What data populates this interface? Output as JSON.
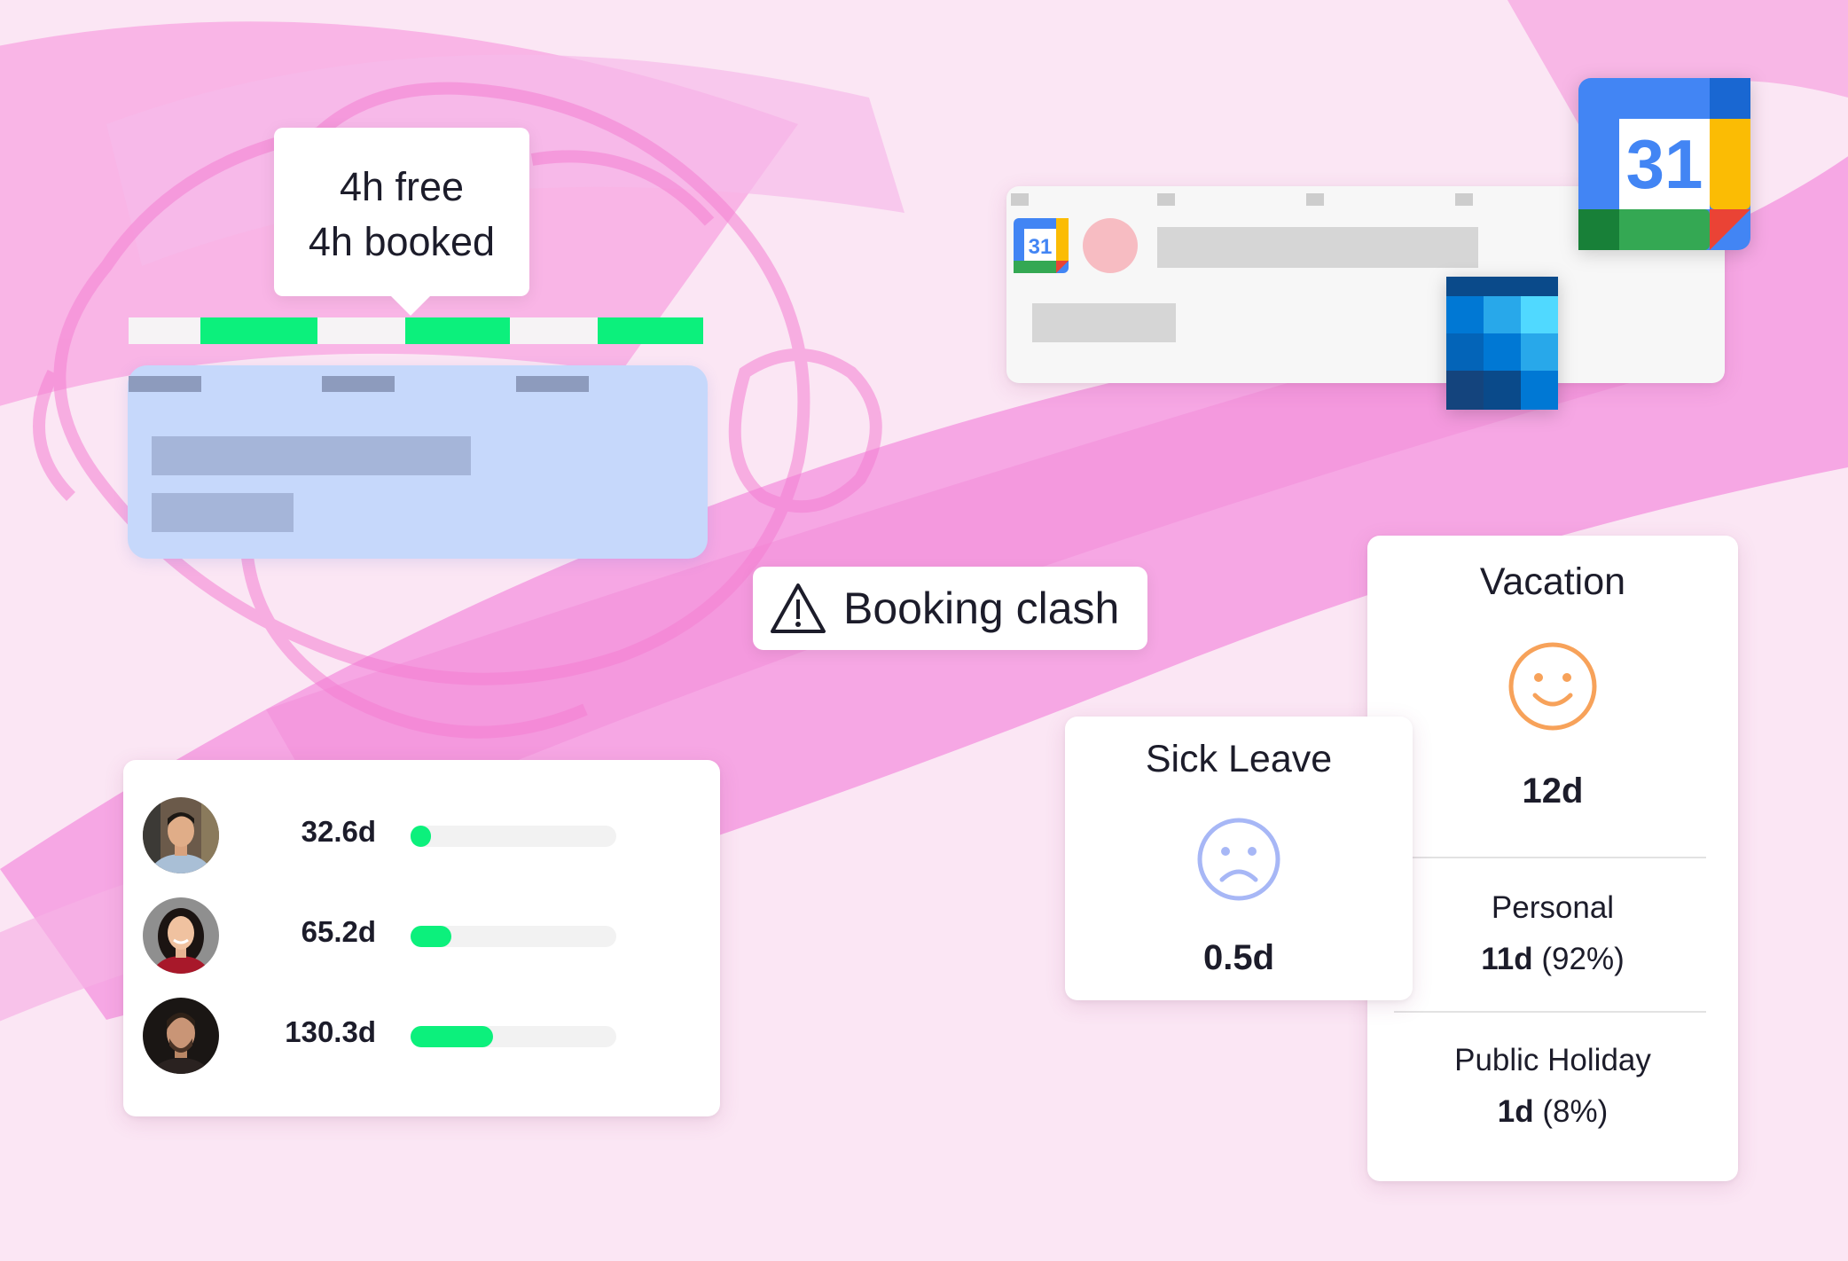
{
  "colors": {
    "background": "#fbe6f4",
    "accent_green": "#0cf07c",
    "booking_blue": "#c6d8fb",
    "happy_orange": "#f7a25a",
    "sad_blue": "#a7b7f6"
  },
  "capacity": {
    "tooltip_line1": "4h free",
    "tooltip_line2": "4h booked"
  },
  "alert": {
    "icon": "warning-icon",
    "label": "Booking clash"
  },
  "calendar_integrations": {
    "large_icon_number": "31",
    "small_icon_number": "31",
    "apps": [
      "google-calendar-icon",
      "microsoft-outlook-icon"
    ]
  },
  "utilization": {
    "rows": [
      {
        "avatar": "avatar-man-glasses",
        "days": "32.6d",
        "level": 0.1
      },
      {
        "avatar": "avatar-woman-smiling",
        "days": "65.2d",
        "level": 0.2
      },
      {
        "avatar": "avatar-man-beard",
        "days": "130.3d",
        "level": 0.4
      }
    ]
  },
  "leave": {
    "vacation": {
      "title": "Vacation",
      "icon": "smiley-face-icon",
      "total": "12d",
      "breakdown": [
        {
          "label": "Personal",
          "days": "11d",
          "percent": "(92%)"
        },
        {
          "label": "Public Holiday",
          "days": "1d",
          "percent": "(8%)"
        }
      ]
    },
    "sick": {
      "title": "Sick Leave",
      "icon": "sad-face-icon",
      "total": "0.5d"
    }
  }
}
